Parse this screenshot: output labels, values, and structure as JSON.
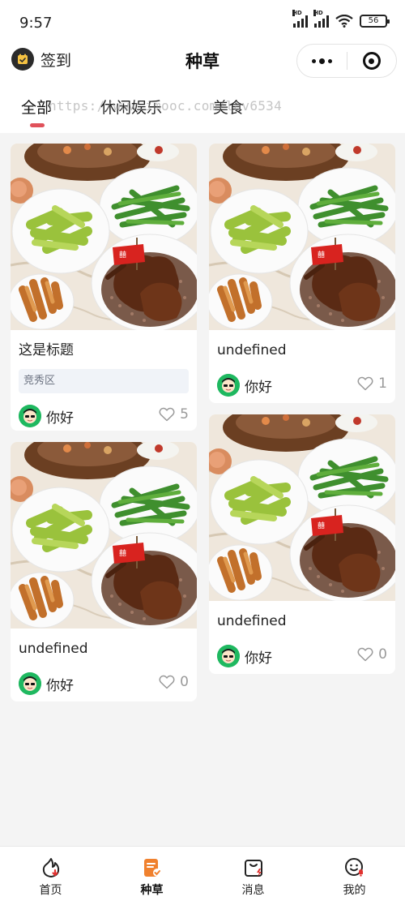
{
  "status_bar": {
    "time": "9:57",
    "signal_1_label": "HD",
    "signal_2_label": "HD",
    "battery": "56"
  },
  "nav": {
    "checkin_label": "签到",
    "title": "种草"
  },
  "tabs": [
    {
      "label": "全部",
      "active": true
    },
    {
      "label": "休闲娱乐",
      "active": false
    },
    {
      "label": "美食",
      "active": false
    }
  ],
  "watermark": "https://www.imooc.com/lav6534",
  "feed": {
    "cards": [
      {
        "title": "这是标题",
        "tag": "竞秀区",
        "author": "你好",
        "likes": "5"
      },
      {
        "title": "undefined",
        "tag": "",
        "author": "你好",
        "likes": "1"
      },
      {
        "title": "undefined",
        "tag": "",
        "author": "你好",
        "likes": "0"
      },
      {
        "title": "undefined",
        "tag": "",
        "author": "你好",
        "likes": "0"
      }
    ]
  },
  "tabbar": [
    {
      "label": "首页",
      "icon": "home-flame-icon",
      "active": false
    },
    {
      "label": "种草",
      "icon": "note-check-icon",
      "active": true
    },
    {
      "label": "消息",
      "icon": "bag-bolt-icon",
      "active": false
    },
    {
      "label": "我的",
      "icon": "smile-bell-icon",
      "active": false
    }
  ],
  "colors": {
    "accent": "#e0515a",
    "active_tab_orange": "#f0812e",
    "tag_bg": "#f0f3f8",
    "avatar_green": "#1fb860"
  }
}
